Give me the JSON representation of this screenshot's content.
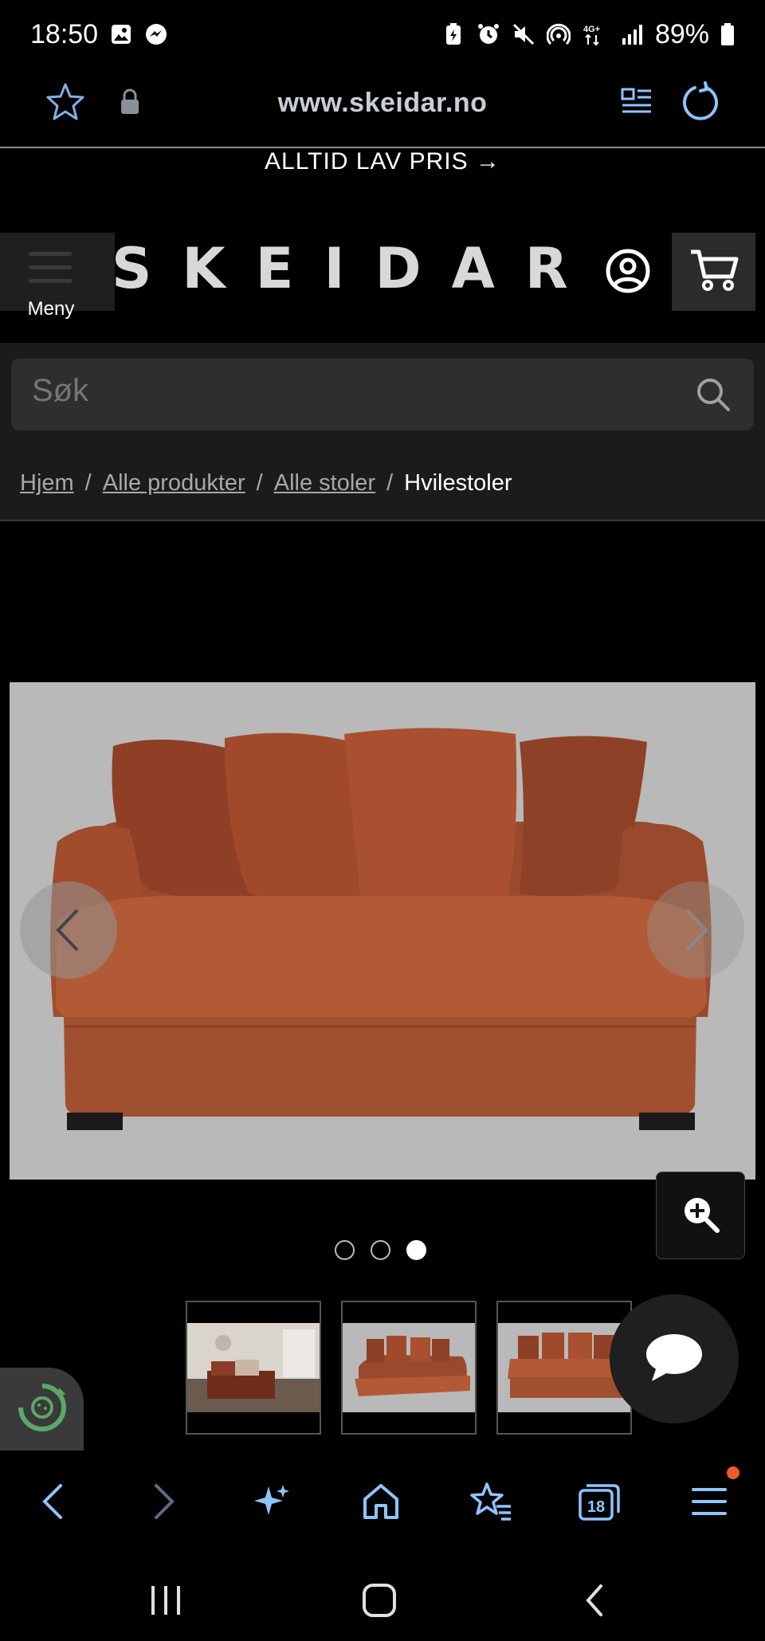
{
  "status_bar": {
    "time": "18:50",
    "battery": "89%",
    "network": "4G+"
  },
  "browser": {
    "url": "www.skeidar.no",
    "tab_count": "18",
    "icons": [
      "star-icon",
      "lock-icon",
      "reader-mode-icon",
      "reload-icon"
    ]
  },
  "site": {
    "promo": "ALLTID LAV PRIS →",
    "logo": "SKEIDAR",
    "menu_label": "Meny",
    "search_placeholder": "Søk"
  },
  "breadcrumb": {
    "items": [
      "Hjem",
      "Alle produkter",
      "Alle stoler"
    ],
    "current": "Hvilestoler",
    "separator": "/"
  },
  "carousel": {
    "slide_count": 3,
    "active_slide": 3,
    "thumbnail_count": 3
  },
  "colors": {
    "background": "#000000",
    "sofa": "#a9512f",
    "image_bg": "#b9b9b9",
    "accent_icon": "#8fc4ff",
    "notification": "#f15a29",
    "eco_green": "#5aa86a"
  }
}
